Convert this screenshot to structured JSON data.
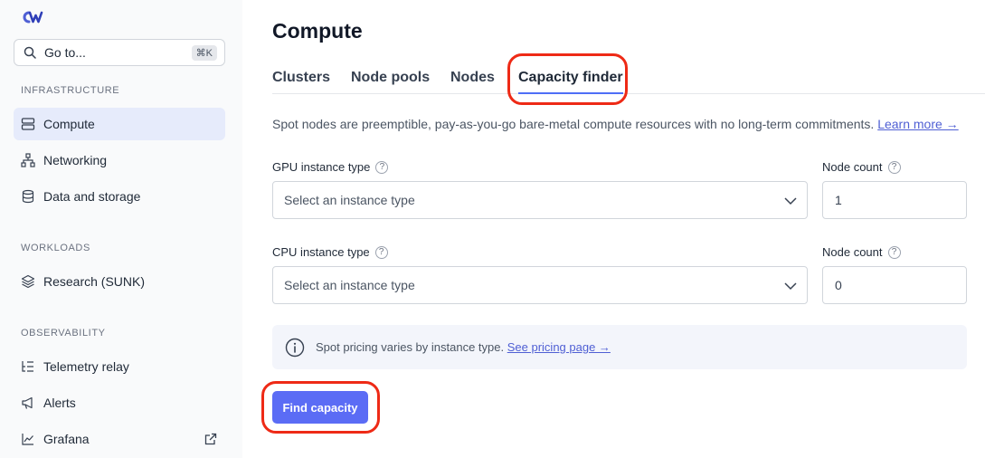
{
  "sidebar": {
    "goto_label": "Go to...",
    "goto_shortcut": "⌘K",
    "sections": [
      {
        "title": "INFRASTRUCTURE",
        "items": [
          {
            "label": "Compute",
            "icon": "server-icon",
            "active": true
          },
          {
            "label": "Networking",
            "icon": "network-icon"
          },
          {
            "label": "Data and storage",
            "icon": "database-icon"
          }
        ]
      },
      {
        "title": "WORKLOADS",
        "items": [
          {
            "label": "Research (SUNK)",
            "icon": "layers-icon"
          }
        ]
      },
      {
        "title": "OBSERVABILITY",
        "items": [
          {
            "label": "Telemetry relay",
            "icon": "list-tree-icon"
          },
          {
            "label": "Alerts",
            "icon": "megaphone-icon"
          },
          {
            "label": "Grafana",
            "icon": "chart-line-icon",
            "external": true
          }
        ]
      }
    ]
  },
  "main": {
    "title": "Compute",
    "tabs": [
      "Clusters",
      "Node pools",
      "Nodes",
      "Capacity finder"
    ],
    "active_tab": "Capacity finder",
    "description": "Spot nodes are preemptible, pay-as-you-go bare-metal compute resources with no long-term commitments.",
    "learn_more": "Learn more →",
    "gpu": {
      "label": "GPU instance type",
      "placeholder": "Select an instance type",
      "count_label": "Node count",
      "count_value": "1"
    },
    "cpu": {
      "label": "CPU instance type",
      "placeholder": "Select an instance type",
      "count_label": "Node count",
      "count_value": "0"
    },
    "info_text": "Spot pricing varies by instance type.",
    "info_link": "See pricing page →",
    "find_button": "Find capacity"
  },
  "colors": {
    "accent": "#5b6cf5",
    "highlight": "#ee2a16",
    "active_nav_bg": "#e6ebfb"
  }
}
